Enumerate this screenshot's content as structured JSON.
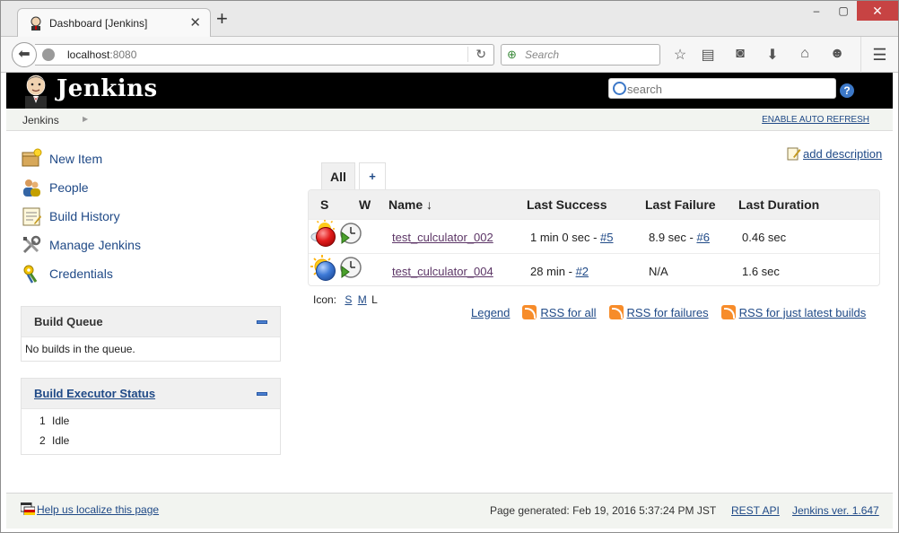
{
  "browser": {
    "tab_title": "Dashboard [Jenkins]",
    "new_tab_label": "+",
    "url_host": "localhost",
    "url_port": ":8080",
    "search_placeholder": "Search"
  },
  "header": {
    "title": "Jenkins",
    "search_placeholder": "search",
    "help_label": "?"
  },
  "breadcrumb": {
    "root": "Jenkins",
    "auto_refresh": "ENABLE AUTO REFRESH"
  },
  "sidebar": {
    "tasks": [
      {
        "label": "New Item",
        "icon": "new-item-icon"
      },
      {
        "label": "People",
        "icon": "people-icon"
      },
      {
        "label": "Build History",
        "icon": "build-history-icon"
      },
      {
        "label": "Manage Jenkins",
        "icon": "manage-jenkins-icon"
      },
      {
        "label": "Credentials",
        "icon": "credentials-icon"
      }
    ],
    "build_queue": {
      "title": "Build Queue",
      "empty_text": "No builds in the queue."
    },
    "executors": {
      "title": "Build Executor Status",
      "rows": [
        {
          "num": "1",
          "state": "Idle"
        },
        {
          "num": "2",
          "state": "Idle"
        }
      ]
    }
  },
  "main": {
    "add_description": "add description",
    "tabs": {
      "all": "All",
      "add": "+"
    },
    "columns": {
      "s": "S",
      "w": "W",
      "name": "Name ↓",
      "last_success": "Last Success",
      "last_failure": "Last Failure",
      "last_duration": "Last Duration"
    },
    "jobs": [
      {
        "status": "failed",
        "status_color": "#e21b1b",
        "weather": "partly-cloudy-icon",
        "name": "test_culculator_002",
        "last_success_text": "1 min 0 sec - ",
        "last_success_build": "#5",
        "last_failure_text": "8.9 sec - ",
        "last_failure_build": "#6",
        "last_duration": "0.46 sec"
      },
      {
        "status": "success",
        "status_color": "#3d79d6",
        "weather": "sunny-icon",
        "name": "test_culculator_004",
        "last_success_text": "28 min - ",
        "last_success_build": "#2",
        "last_failure_text": "N/A",
        "last_failure_build": "",
        "last_duration": "1.6 sec"
      }
    ],
    "icon_size": {
      "label": "Icon:",
      "small": "S",
      "medium": "M",
      "large": "L"
    },
    "legend": "Legend",
    "rss_all": "RSS for all",
    "rss_failures": "RSS for failures",
    "rss_latest": "RSS for just latest builds"
  },
  "footer": {
    "localize": "Help us localize this page",
    "generated": "Page generated: Feb 19, 2016 5:37:24 PM JST",
    "rest_api": "REST API",
    "version": "Jenkins ver. 1.647"
  }
}
